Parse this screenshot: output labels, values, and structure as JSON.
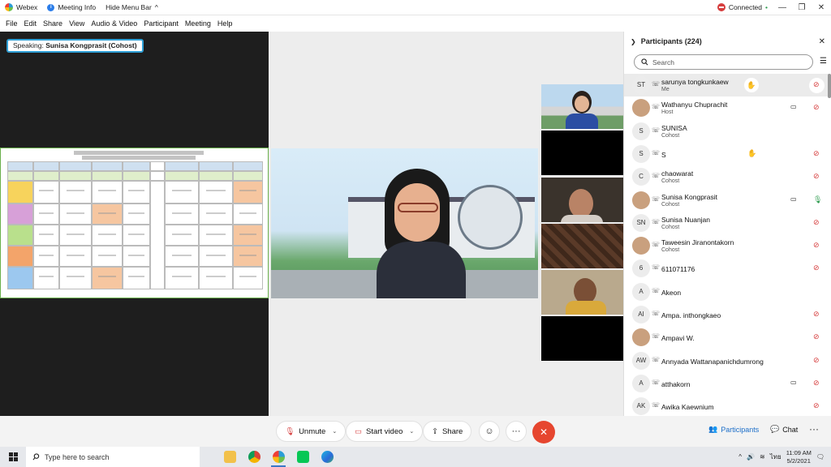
{
  "titlebar": {
    "app_name": "Webex",
    "meeting_info": "Meeting Info",
    "hide_menu": "Hide Menu Bar",
    "hide_menu_chevron": "^",
    "status": "Connected",
    "status_chevron": "•",
    "minimize": "—",
    "restore": "❐",
    "close": "✕"
  },
  "menu": {
    "items": [
      "File",
      "Edit",
      "Share",
      "View",
      "Audio & Video",
      "Participant",
      "Meeting",
      "Help"
    ]
  },
  "stage": {
    "speaking_prefix": "Speaking:",
    "speaking_name": "Sunisa Kongprasit (Cohost)"
  },
  "panel": {
    "title": "Participants (224)",
    "chevron": "❯",
    "close": "✕",
    "search_placeholder": "Search",
    "participants": [
      {
        "initials": "ST",
        "name": "sarunya tongkunkaew",
        "role": "Me",
        "hand": true,
        "cam": false,
        "mic": "muted",
        "photo": false
      },
      {
        "initials": "",
        "name": "Wathanyu Chuprachit",
        "role": "Host",
        "hand": false,
        "cam": true,
        "mic": "muted",
        "photo": true
      },
      {
        "initials": "S",
        "name": "SUNISA",
        "role": "Cohost",
        "hand": false,
        "cam": false,
        "mic": "none",
        "photo": false
      },
      {
        "initials": "S",
        "name": "S",
        "role": "",
        "hand": true,
        "cam": false,
        "mic": "muted",
        "photo": false
      },
      {
        "initials": "C",
        "name": "chaowarat",
        "role": "Cohost",
        "hand": false,
        "cam": false,
        "mic": "muted",
        "photo": false
      },
      {
        "initials": "",
        "name": "Sunisa Kongprasit",
        "role": "Cohost",
        "hand": false,
        "cam": true,
        "mic": "on",
        "photo": true
      },
      {
        "initials": "SN",
        "name": "Sunisa Nuanjan",
        "role": "Cohost",
        "hand": false,
        "cam": false,
        "mic": "muted",
        "photo": false
      },
      {
        "initials": "",
        "name": "Taweesin Jiranontakorn",
        "role": "Cohost",
        "hand": false,
        "cam": false,
        "mic": "muted",
        "photo": true
      },
      {
        "initials": "6",
        "name": "611071176",
        "role": "",
        "hand": false,
        "cam": false,
        "mic": "muted",
        "photo": false
      },
      {
        "initials": "A",
        "name": "Akeon",
        "role": "",
        "hand": false,
        "cam": false,
        "mic": "none",
        "photo": false
      },
      {
        "initials": "AI",
        "name": "Ampa. inthongkaeo",
        "role": "",
        "hand": false,
        "cam": false,
        "mic": "muted",
        "photo": false
      },
      {
        "initials": "",
        "name": "Ampavi W.",
        "role": "",
        "hand": false,
        "cam": false,
        "mic": "muted",
        "photo": true
      },
      {
        "initials": "AW",
        "name": "Annyada Wattanapanichdumrong",
        "role": "",
        "hand": false,
        "cam": false,
        "mic": "muted",
        "photo": false
      },
      {
        "initials": "A",
        "name": "atthakorn",
        "role": "",
        "hand": false,
        "cam": true,
        "mic": "muted",
        "photo": false
      },
      {
        "initials": "AK",
        "name": "Awika Kaewnium",
        "role": "",
        "hand": false,
        "cam": false,
        "mic": "muted",
        "photo": false
      }
    ]
  },
  "controls": {
    "unmute": "Unmute",
    "start_video": "Start video",
    "share": "Share",
    "participants_tab": "Participants",
    "chat_tab": "Chat",
    "more": "···",
    "chevron": "⌄",
    "leave": "✕"
  },
  "taskbar": {
    "search_placeholder": "Type here to search",
    "time": "11:09 AM",
    "date": "5/2/2021",
    "lang": "ไทย"
  },
  "colors": {
    "accent": "#1d6fc9",
    "leave": "#e6462f",
    "muted": "#d63d3d",
    "speaking_border": "#2e9fd5"
  }
}
